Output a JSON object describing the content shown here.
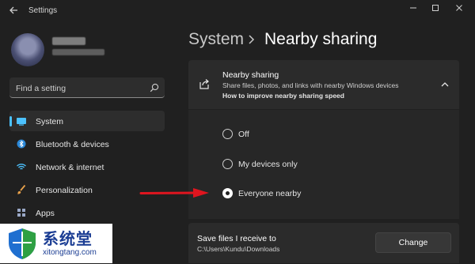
{
  "window": {
    "title": "Settings"
  },
  "sidebar": {
    "search_placeholder": "Find a setting",
    "items": [
      {
        "label": "System",
        "icon": "monitor-icon",
        "active": true
      },
      {
        "label": "Bluetooth & devices",
        "icon": "bluetooth-icon",
        "active": false
      },
      {
        "label": "Network & internet",
        "icon": "wifi-icon",
        "active": false
      },
      {
        "label": "Personalization",
        "icon": "brush-icon",
        "active": false
      },
      {
        "label": "Apps",
        "icon": "apps-icon",
        "active": false
      }
    ]
  },
  "header": {
    "section": "System",
    "page": "Nearby sharing"
  },
  "nearby": {
    "title": "Nearby sharing",
    "description": "Share files, photos, and links with nearby Windows devices",
    "link": "How to improve nearby sharing speed",
    "options": [
      {
        "label": "Off",
        "selected": false
      },
      {
        "label": "My devices only",
        "selected": false
      },
      {
        "label": "Everyone nearby",
        "selected": true
      }
    ]
  },
  "save": {
    "title": "Save files I receive to",
    "path": "C:\\Users\\Kundu\\Downloads",
    "button": "Change"
  },
  "watermark": {
    "brand": "系统堂",
    "url": "xitongtang.com"
  },
  "colors": {
    "accent": "#4cc2ff",
    "arrow": "#e0151f",
    "background": "#202020"
  }
}
